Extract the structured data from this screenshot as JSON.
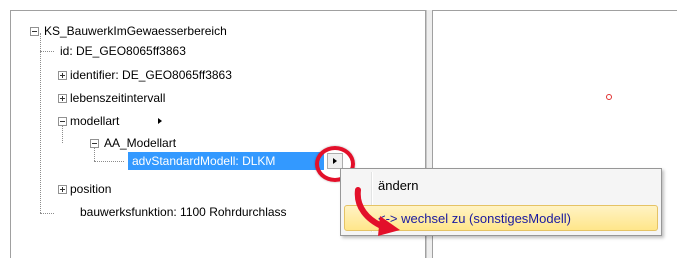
{
  "tree": {
    "items": [
      {
        "label": "KS_BauwerkImGewaesserbereich"
      },
      {
        "label": "id: DE_GEO8065ff3863"
      },
      {
        "label": "identifier: DE_GEO8065ff3863"
      },
      {
        "label": "lebenszeitintervall"
      },
      {
        "label": "modellart"
      },
      {
        "label": "AA_Modellart"
      },
      {
        "label": "advStandardModell: DLKM"
      },
      {
        "label": "position"
      },
      {
        "label": "bauwerksfunktion: 1100 Rohrdurchlass"
      }
    ]
  },
  "context_menu": {
    "items": [
      {
        "label": "ändern"
      },
      {
        "label": "<-> wechsel zu (sonstigesModell)"
      }
    ]
  },
  "colors": {
    "selection": "#3399ff",
    "highlight_ring": "#e3102a",
    "menu_hover": "#ffe68a",
    "map_point": "#e03030"
  }
}
